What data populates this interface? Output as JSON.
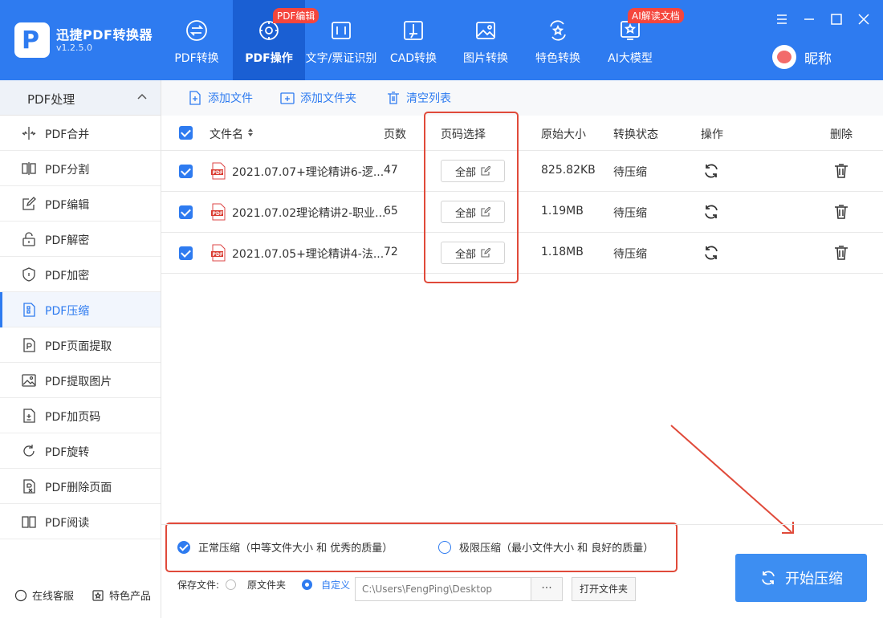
{
  "app": {
    "name": "迅捷PDF转换器",
    "version": "v1.2.5.0"
  },
  "nav": [
    {
      "label": "PDF转换",
      "icon": "swap-icon"
    },
    {
      "label": "PDF操作",
      "icon": "gear-icon",
      "badge": "PDF编辑",
      "active": true
    },
    {
      "label": "文字/票证识别",
      "icon": "scan-text-icon"
    },
    {
      "label": "CAD转换",
      "icon": "cad-icon"
    },
    {
      "label": "图片转换",
      "icon": "image-icon"
    },
    {
      "label": "特色转换",
      "icon": "star-icon"
    },
    {
      "label": "AI大模型",
      "icon": "ai-star-icon",
      "badge": "AI解读文档"
    }
  ],
  "user": {
    "name": "昵称"
  },
  "sidebar": {
    "header": "PDF处理",
    "items": [
      {
        "label": "PDF合并",
        "icon": "merge-icon"
      },
      {
        "label": "PDF分割",
        "icon": "split-icon"
      },
      {
        "label": "PDF编辑",
        "icon": "edit-icon"
      },
      {
        "label": "PDF解密",
        "icon": "unlock-icon"
      },
      {
        "label": "PDF加密",
        "icon": "shield-icon"
      },
      {
        "label": "PDF压缩",
        "icon": "compress-icon",
        "active": true
      },
      {
        "label": "PDF页面提取",
        "icon": "page-extract-icon"
      },
      {
        "label": "PDF提取图片",
        "icon": "image-extract-icon"
      },
      {
        "label": "PDF加页码",
        "icon": "page-number-icon"
      },
      {
        "label": "PDF旋转",
        "icon": "rotate-icon"
      },
      {
        "label": "PDF删除页面",
        "icon": "page-delete-icon"
      },
      {
        "label": "PDF阅读",
        "icon": "book-icon"
      }
    ],
    "footer": {
      "service": "在线客服",
      "products": "特色产品"
    }
  },
  "toolbar": {
    "add_file": "添加文件",
    "add_folder": "添加文件夹",
    "clear_list": "清空列表"
  },
  "table": {
    "headers": {
      "filename": "文件名",
      "pages": "页数",
      "page_select": "页码选择",
      "size": "原始大小",
      "status": "转换状态",
      "action": "操作",
      "delete": "删除"
    },
    "rows": [
      {
        "filename": "2021.07.07+理论精讲6-逻...",
        "pages": "47",
        "page_select": "全部",
        "size": "825.82KB",
        "status": "待压缩"
      },
      {
        "filename": "2021.07.02理论精讲2-职业...",
        "pages": "65",
        "page_select": "全部",
        "size": "1.19MB",
        "status": "待压缩"
      },
      {
        "filename": "2021.07.05+理论精讲4-法...",
        "pages": "72",
        "page_select": "全部",
        "size": "1.18MB",
        "status": "待压缩"
      }
    ]
  },
  "compression": {
    "normal": "正常压缩（中等文件大小 和 优秀的质量）",
    "extreme": "极限压缩（最小文件大小 和 良好的质量）"
  },
  "save": {
    "label": "保存文件:",
    "option_original": "原文件夹",
    "option_custom": "自定义",
    "path": "C:\\Users\\FengPing\\Desktop",
    "dots": "···",
    "open_folder": "打开文件夹"
  },
  "start_button": "开始压缩",
  "colors": {
    "primary": "#2e7bf0",
    "header_active": "#1a5fd3",
    "badge": "#f5463d",
    "annotation": "#e04a3a",
    "start": "#3d8ef2"
  }
}
